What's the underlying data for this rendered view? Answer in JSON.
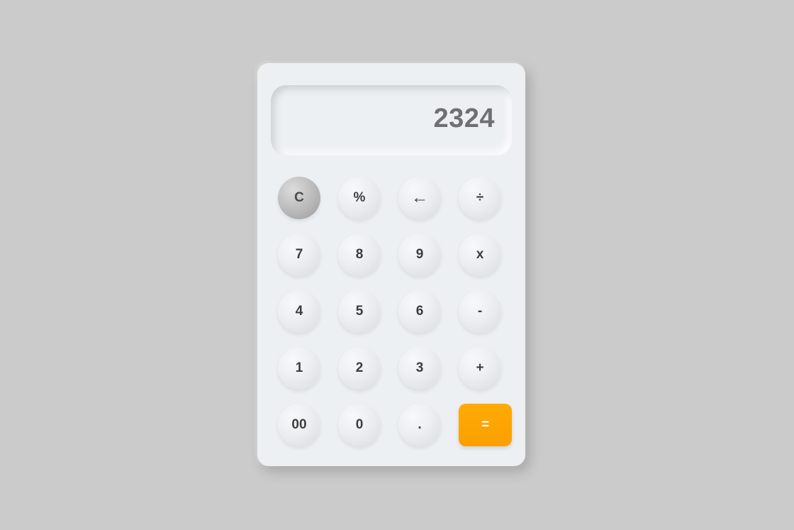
{
  "display": {
    "value": "2324"
  },
  "keys": {
    "clear": "C",
    "percent": "%",
    "backspace": "←",
    "divide": "÷",
    "seven": "7",
    "eight": "8",
    "nine": "9",
    "multiply": "x",
    "four": "4",
    "five": "5",
    "six": "6",
    "subtract": "-",
    "one": "1",
    "two": "2",
    "three": "3",
    "add": "+",
    "double_zero": "00",
    "zero": "0",
    "decimal": ".",
    "equals": "="
  },
  "colors": {
    "background": "#cbcbcb",
    "body": "#edf0f3",
    "display_text": "#707070",
    "key_text": "#3d3d3d",
    "equals_accent": "#ffa500"
  }
}
